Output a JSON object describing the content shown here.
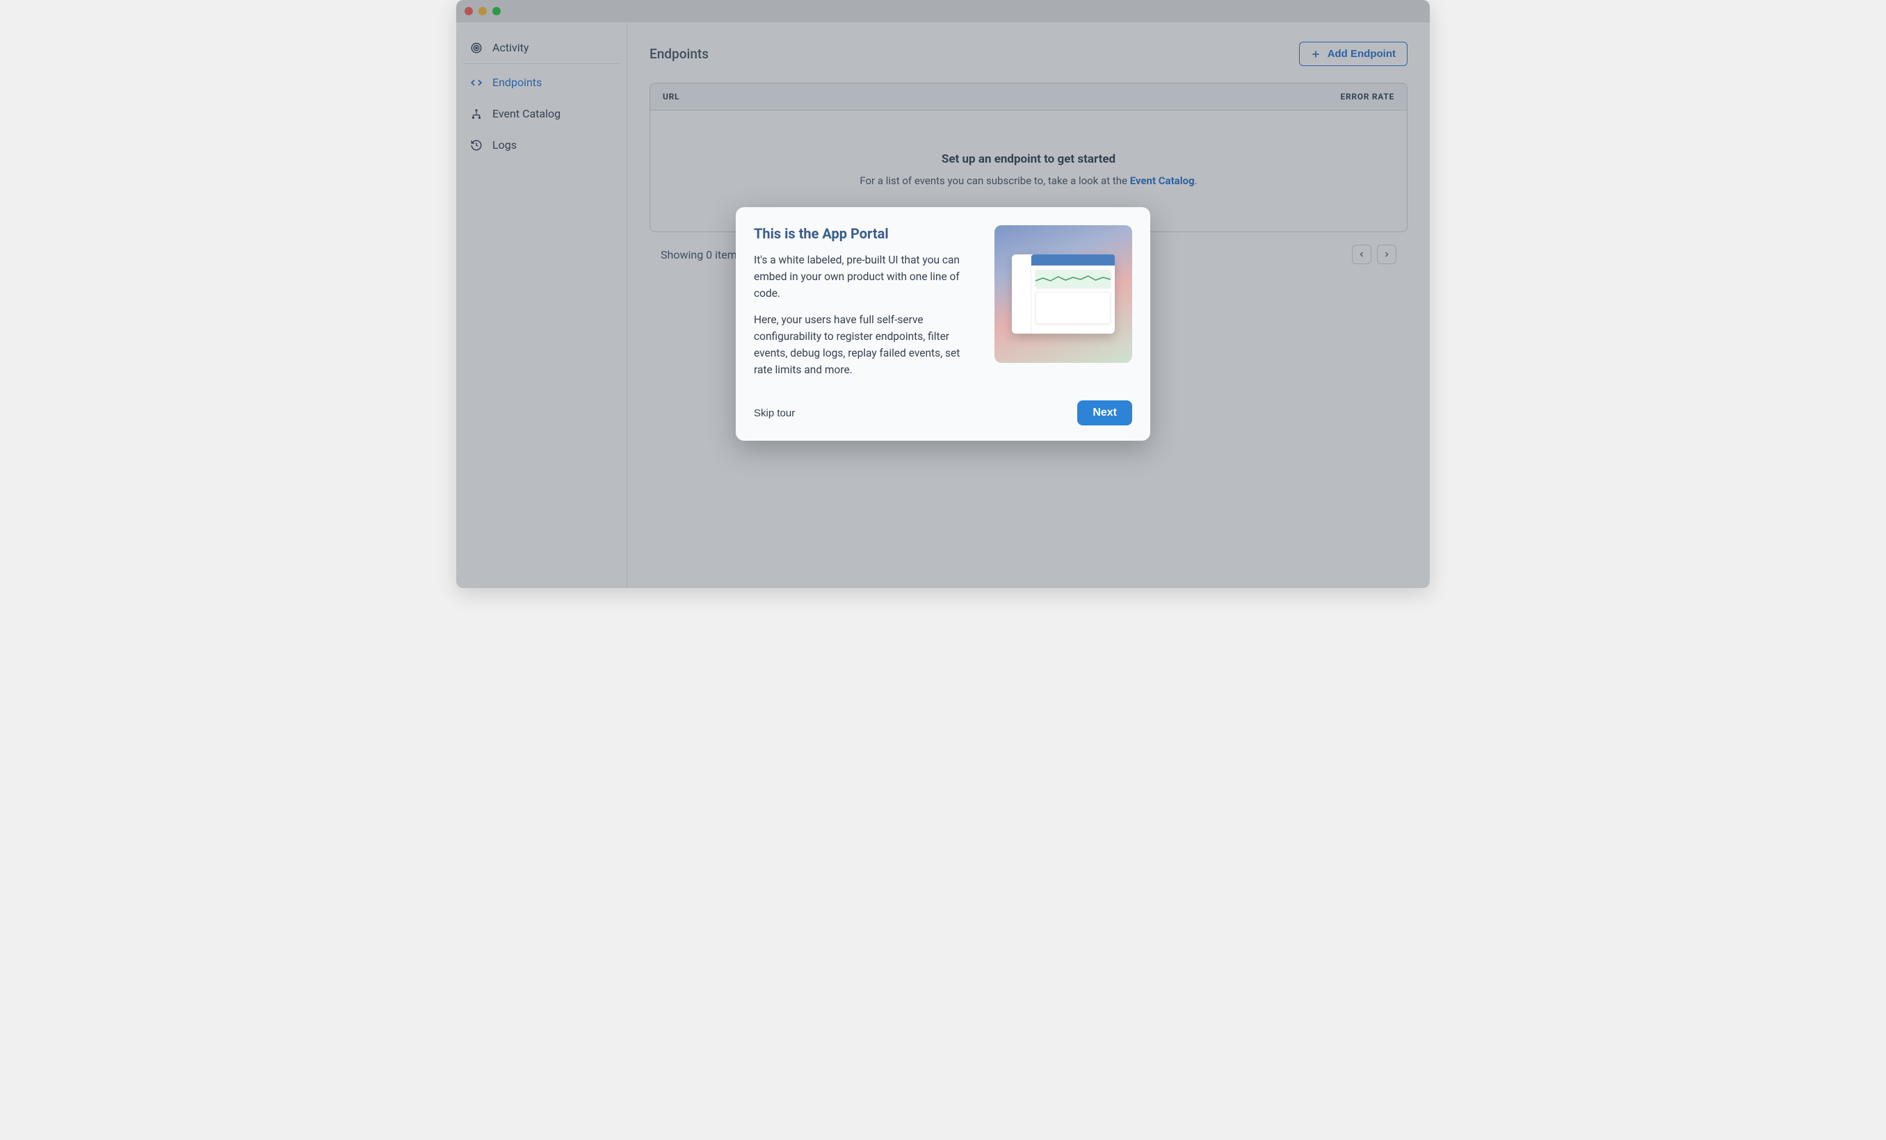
{
  "sidebar": {
    "items": [
      {
        "label": "Activity",
        "active": false
      },
      {
        "label": "Endpoints",
        "active": true
      },
      {
        "label": "Event Catalog",
        "active": false
      },
      {
        "label": "Logs",
        "active": false
      }
    ]
  },
  "main": {
    "title": "Endpoints",
    "add_button": "Add Endpoint",
    "columns": {
      "url": "URL",
      "error_rate": "ERROR RATE"
    },
    "empty": {
      "title": "Set up an endpoint to get started",
      "subtitle_pre": "For a list of events you can subscribe to, take a look at the ",
      "subtitle_link": "Event Catalog",
      "subtitle_post": "."
    },
    "footer_showing": "Showing 0 items"
  },
  "modal": {
    "title": "This is the App Portal",
    "p1": "It's a white labeled, pre-built UI that you can embed in your own product with one line of code.",
    "p2": "Here, your users have full self-serve configurability to register endpoints, filter events, debug logs, replay failed events, set rate limits and more.",
    "skip_label": "Skip tour",
    "next_label": "Next"
  }
}
